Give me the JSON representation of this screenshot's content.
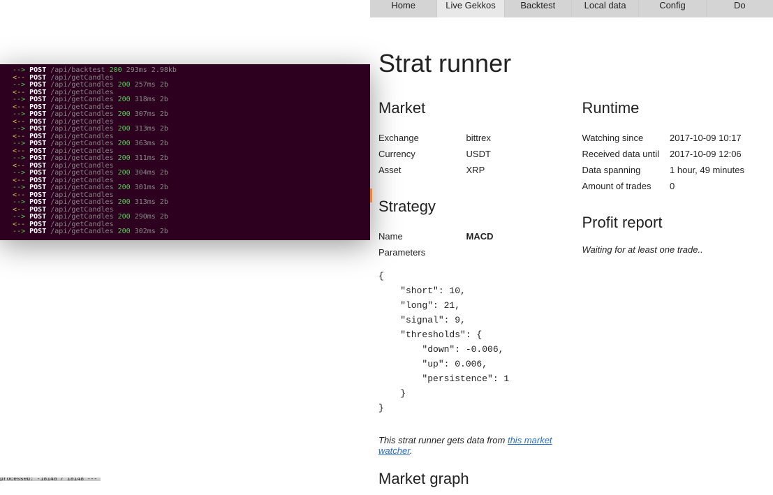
{
  "nav": {
    "tabs": [
      {
        "label": "Home",
        "active": false
      },
      {
        "label": "Live Gekkos",
        "active": true
      },
      {
        "label": "Backtest",
        "active": false
      },
      {
        "label": "Local data",
        "active": false
      },
      {
        "label": "Config",
        "active": false
      },
      {
        "label": "Do",
        "active": false
      }
    ]
  },
  "page_title": "Strat runner",
  "market": {
    "heading": "Market",
    "rows": [
      {
        "label": "Exchange",
        "value": "bittrex"
      },
      {
        "label": "Currency",
        "value": "USDT"
      },
      {
        "label": "Asset",
        "value": "XRP"
      }
    ]
  },
  "runtime": {
    "heading": "Runtime",
    "rows": [
      {
        "label": "Watching since",
        "value": "2017-10-09 10:17"
      },
      {
        "label": "Received data until",
        "value": "2017-10-09 12:06"
      },
      {
        "label": "Data spanning",
        "value": "1 hour, 49 minutes"
      },
      {
        "label": "Amount of trades",
        "value": "0"
      }
    ]
  },
  "strategy": {
    "heading": "Strategy",
    "name_label": "Name",
    "name_value": "MACD",
    "params_label": "Parameters",
    "params_json": "{\n    \"short\": 10,\n    \"long\": 21,\n    \"signal\": 9,\n    \"thresholds\": {\n        \"down\": -0.006,\n        \"up\": 0.006,\n        \"persistence\": 1\n    }\n}"
  },
  "profit": {
    "heading": "Profit report",
    "waiting": "Waiting for at least one trade.."
  },
  "footnote": {
    "prefix": "This strat runner gets data from ",
    "link_text": "this market watcher",
    "suffix": "."
  },
  "graph_heading": "Market graph",
  "terminal": {
    "lines": [
      {
        "dir": "out",
        "method": "POST",
        "path": "/api/backtest",
        "status": "200",
        "timing": "293ms 2.98kb"
      },
      {
        "dir": "in",
        "method": "POST",
        "path": "/api/getCandles"
      },
      {
        "dir": "out",
        "method": "POST",
        "path": "/api/getCandles",
        "status": "200",
        "timing": "257ms 2b"
      },
      {
        "dir": "in",
        "method": "POST",
        "path": "/api/getCandles"
      },
      {
        "dir": "out",
        "method": "POST",
        "path": "/api/getCandles",
        "status": "200",
        "timing": "318ms 2b"
      },
      {
        "dir": "in",
        "method": "POST",
        "path": "/api/getCandles"
      },
      {
        "dir": "out",
        "method": "POST",
        "path": "/api/getCandles",
        "status": "200",
        "timing": "307ms 2b"
      },
      {
        "dir": "in",
        "method": "POST",
        "path": "/api/getCandles"
      },
      {
        "dir": "out",
        "method": "POST",
        "path": "/api/getCandles",
        "status": "200",
        "timing": "313ms 2b"
      },
      {
        "dir": "in",
        "method": "POST",
        "path": "/api/getCandles"
      },
      {
        "dir": "out",
        "method": "POST",
        "path": "/api/getCandles",
        "status": "200",
        "timing": "363ms 2b"
      },
      {
        "dir": "in",
        "method": "POST",
        "path": "/api/getCandles"
      },
      {
        "dir": "out",
        "method": "POST",
        "path": "/api/getCandles",
        "status": "200",
        "timing": "311ms 2b"
      },
      {
        "dir": "in",
        "method": "POST",
        "path": "/api/getCandles"
      },
      {
        "dir": "out",
        "method": "POST",
        "path": "/api/getCandles",
        "status": "200",
        "timing": "304ms 2b"
      },
      {
        "dir": "in",
        "method": "POST",
        "path": "/api/getCandles"
      },
      {
        "dir": "out",
        "method": "POST",
        "path": "/api/getCandles",
        "status": "200",
        "timing": "301ms 2b"
      },
      {
        "dir": "in",
        "method": "POST",
        "path": "/api/getCandles"
      },
      {
        "dir": "out",
        "method": "POST",
        "path": "/api/getCandles",
        "status": "200",
        "timing": "313ms 2b"
      },
      {
        "dir": "in",
        "method": "POST",
        "path": "/api/getCandles"
      },
      {
        "dir": "out",
        "method": "POST",
        "path": "/api/getCandles",
        "status": "200",
        "timing": "290ms 2b"
      },
      {
        "dir": "in",
        "method": "POST",
        "path": "/api/getCandles"
      },
      {
        "dir": "out",
        "method": "POST",
        "path": "/api/getCandles",
        "status": "200",
        "timing": "302ms 2b"
      }
    ]
  },
  "status_bar": "processed: -18148 / 18148 ------"
}
